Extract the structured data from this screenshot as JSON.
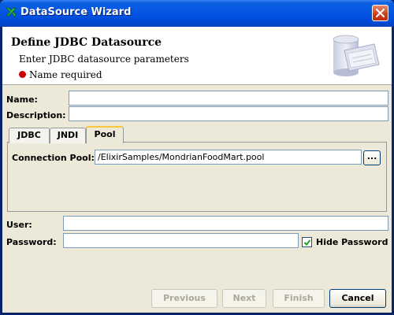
{
  "window": {
    "title": "DataSource Wizard"
  },
  "header": {
    "title": "Define JDBC Datasource",
    "subtitle": "Enter JDBC datasource parameters",
    "error": "Name required"
  },
  "form": {
    "name_label": "Name:",
    "name_value": "",
    "description_label": "Description:",
    "description_value": "",
    "user_label": "User:",
    "user_value": "",
    "password_label": "Password:",
    "password_value": "",
    "hide_password_label": "Hide Password",
    "hide_password_checked": true
  },
  "tabs": {
    "items": [
      {
        "label": "JDBC"
      },
      {
        "label": "JNDI"
      },
      {
        "label": "Pool"
      }
    ],
    "active": "Pool"
  },
  "pool": {
    "connection_pool_label": "Connection Pool:",
    "connection_pool_value": "/ElixirSamples/MondrianFoodMart.pool",
    "browse_label": "..."
  },
  "buttons": {
    "previous": "Previous",
    "next": "Next",
    "finish": "Finish",
    "cancel": "Cancel"
  },
  "colors": {
    "titlebar": "#0554e3",
    "error_dot": "#cc0000",
    "tab_highlight": "#ffc83c"
  }
}
